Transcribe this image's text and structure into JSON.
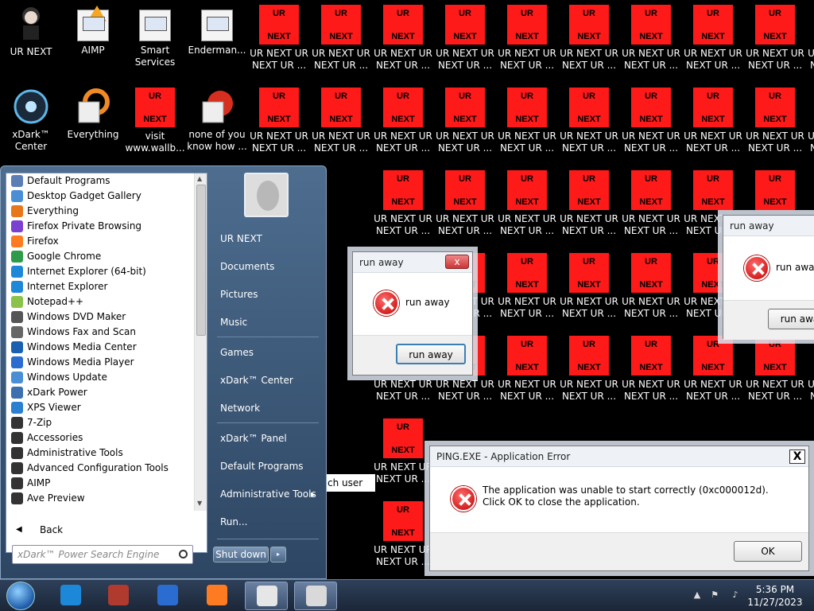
{
  "desktop": {
    "icons": [
      {
        "label": "UR NEXT",
        "kind": "app",
        "icon": "doll-icon"
      },
      {
        "label": "AIMP",
        "kind": "app",
        "icon": "aimp-icon"
      },
      {
        "label": "Smart Services",
        "kind": "app",
        "icon": "gear-icon"
      },
      {
        "label": "Enderman...",
        "kind": "app",
        "icon": "window-icon"
      },
      {
        "label": "xDark™ Center",
        "kind": "app",
        "icon": "orb-icon"
      },
      {
        "label": "Everything",
        "kind": "app",
        "icon": "everything-icon"
      },
      {
        "label": "visit www.wallb...",
        "kind": "ur",
        "icon": "ur-next-icon"
      },
      {
        "label": "none of you know how ...",
        "kind": "app",
        "icon": "red-circle-icon"
      }
    ],
    "ur_icon_top": "UR",
    "ur_icon_bottom": "NEXT",
    "ur_repeat_label_1": "UR NEXT UR NEXT UR ...",
    "ur_repeat_label_2": "NEXT UR NEXT UR ...",
    "ur_partial_1": "UR NEXT UR",
    "ur_partial_2": "NEXT UR ...",
    "ur_clip_1": "UR NEX",
    "ur_clip_2": "NEXT U",
    "ur_fragment": "ch user"
  },
  "start_menu": {
    "programs": [
      {
        "label": "Default Programs",
        "color": "#5b7fb5"
      },
      {
        "label": "Desktop Gadget Gallery",
        "color": "#4a8fd6"
      },
      {
        "label": "Everything",
        "color": "#e8771c"
      },
      {
        "label": "Firefox Private Browsing",
        "color": "#7b3fd1"
      },
      {
        "label": "Firefox",
        "color": "#ff7b21"
      },
      {
        "label": "Google Chrome",
        "color": "#2e9b4a"
      },
      {
        "label": "Internet Explorer (64-bit)",
        "color": "#1e88d8"
      },
      {
        "label": "Internet Explorer",
        "color": "#1e88d8"
      },
      {
        "label": "Notepad++",
        "color": "#8bc34a"
      },
      {
        "label": "Windows DVD Maker",
        "color": "#555555"
      },
      {
        "label": "Windows Fax and Scan",
        "color": "#666666"
      },
      {
        "label": "Windows Media Center",
        "color": "#1b5fb0"
      },
      {
        "label": "Windows Media Player",
        "color": "#2b6cd1"
      },
      {
        "label": "Windows Update",
        "color": "#4a8fd6"
      },
      {
        "label": "xDark Power",
        "color": "#3b6fb0"
      },
      {
        "label": "XPS Viewer",
        "color": "#2a7fd1"
      },
      {
        "label": "7-Zip",
        "color": "#333333"
      },
      {
        "label": "Accessories",
        "color": "#333333"
      },
      {
        "label": "Administrative Tools",
        "color": "#333333"
      },
      {
        "label": "Advanced Configuration Tools",
        "color": "#333333"
      },
      {
        "label": "AIMP",
        "color": "#333333"
      },
      {
        "label": "Ave Preview",
        "color": "#333333"
      }
    ],
    "back_label": "Back",
    "search_placeholder": "xDark™ Power Search Engine",
    "right_links": [
      "UR NEXT",
      "Documents",
      "Pictures",
      "Music",
      "Games",
      "xDark™ Center",
      "Network",
      "xDark™ Panel",
      "Default Programs",
      "Administrative Tools",
      "Run..."
    ],
    "submenu_arrow": "▸",
    "shutdown_label": "Shut down",
    "shutdown_arrow": "▸"
  },
  "dialogs": {
    "run_away_1": {
      "title": "run away",
      "message": "run away",
      "button": "run away",
      "close": "x"
    },
    "run_away_2": {
      "title": "run away",
      "message": "run away",
      "button": "run awa"
    },
    "ping_error": {
      "title": "PING.EXE - Application Error",
      "message": "The application was unable to start correctly (0xc000012d). Click OK to close the application.",
      "button": "OK",
      "close": "X"
    }
  },
  "taskbar": {
    "time": "5:36 PM",
    "date": "11/27/2023",
    "buttons": [
      {
        "name": "internet-explorer",
        "color": "#1e88d8"
      },
      {
        "name": "archive",
        "color": "#b03a2e"
      },
      {
        "name": "music",
        "color": "#2b6cd1"
      },
      {
        "name": "firefox",
        "color": "#ff7b21"
      },
      {
        "name": "app-window",
        "color": "#e6e6e6"
      },
      {
        "name": "explorer-window",
        "color": "#d9d9d9"
      }
    ],
    "tray": [
      "▲",
      "⚑",
      "♪"
    ]
  }
}
